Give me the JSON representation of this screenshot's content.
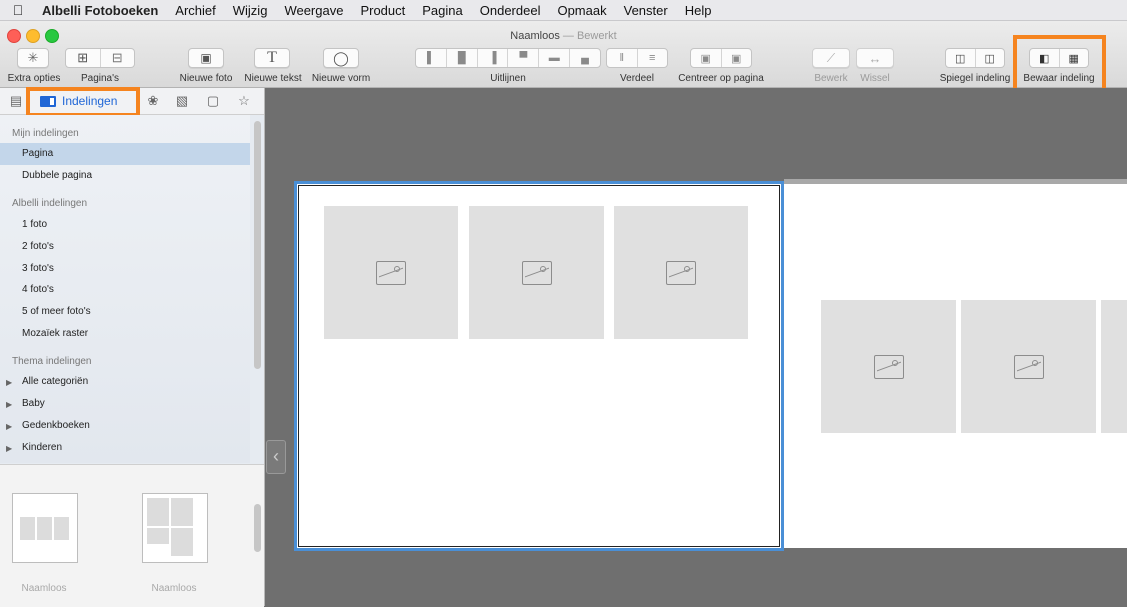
{
  "menubar": {
    "app_name": "Albelli Fotoboeken",
    "items": [
      "Archief",
      "Wijzig",
      "Weergave",
      "Product",
      "Pagina",
      "Onderdeel",
      "Opmaak",
      "Venster",
      "Help"
    ]
  },
  "window": {
    "title": "Naamloos",
    "title_sep": " — ",
    "status": "Bewerkt"
  },
  "toolbar": {
    "extra_opties": "Extra opties",
    "paginas": "Pagina's",
    "nieuwe_foto": "Nieuwe foto",
    "nieuwe_tekst": "Nieuwe tekst",
    "nieuwe_vorm": "Nieuwe vorm",
    "uitlijnen": "Uitlijnen",
    "verdeel": "Verdeel",
    "centreer": "Centreer op pagina",
    "bewerk": "Bewerk",
    "wissel": "Wissel",
    "spiegel": "Spiegel indeling",
    "bewaar": "Bewaar indeling"
  },
  "sidebar": {
    "active_tab": "Indelingen",
    "sections": {
      "mijn": "Mijn indelingen",
      "albelli": "Albelli indelingen",
      "thema": "Thema indelingen"
    },
    "mijn_items": [
      "Pagina",
      "Dubbele pagina"
    ],
    "albelli_items": [
      "1 foto",
      "2 foto's",
      "3 foto's",
      "4 foto's",
      "5 of meer foto's",
      "Mozaïek raster"
    ],
    "thema_items": [
      "Alle categoriën",
      "Baby",
      "Gedenkboeken",
      "Kinderen"
    ],
    "thumbnails": [
      "Naamloos",
      "Naamloos"
    ]
  },
  "colors": {
    "highlight": "#f5841f",
    "selection": "#c3d6ea",
    "accent_blue": "#1f66d6",
    "page_border": "#4a8fd6"
  }
}
